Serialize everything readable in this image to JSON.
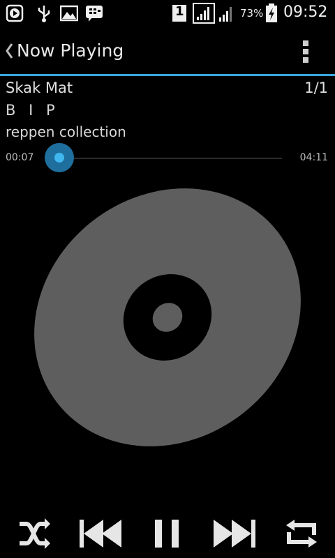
{
  "status_bar": {
    "sim_slot": "1",
    "battery_percent": "73%",
    "time": "09:52",
    "icons": [
      "media-play-icon",
      "usb-icon",
      "gallery-icon",
      "bbm-icon",
      "sim-icon",
      "signal-icon",
      "signal-icon",
      "battery-charging-icon"
    ]
  },
  "action_bar": {
    "title": "Now Playing",
    "back_icon": "chevron-left-icon",
    "overflow_icon": "overflow-menu-icon"
  },
  "track": {
    "title": "Skak Mat",
    "position": "1/1",
    "artist": "B I P",
    "album": "reppen collection"
  },
  "progress": {
    "elapsed": "00:07",
    "total": "04:11",
    "fraction": 0.028
  },
  "controls": {
    "shuffle_icon": "shuffle-icon",
    "previous_icon": "previous-icon",
    "pause_icon": "pause-icon",
    "next_icon": "next-icon",
    "repeat_icon": "repeat-icon"
  },
  "colors": {
    "accent": "#3aa5dc",
    "seek_thumb": "#3fb8ef",
    "disc": "#5e5e5e"
  }
}
